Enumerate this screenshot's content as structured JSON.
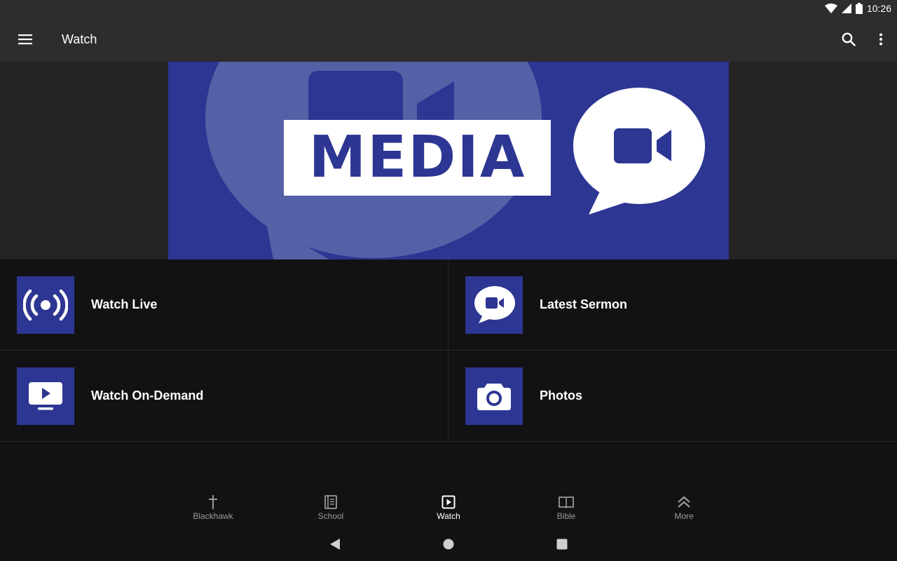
{
  "status_bar": {
    "time": "10:26"
  },
  "app_bar": {
    "title": "Watch"
  },
  "hero": {
    "text": "MEDIA",
    "colors": {
      "background": "#2d3692",
      "bubble_dim": "#5560a6",
      "accent": "#ffffff"
    }
  },
  "tiles": [
    {
      "label": "Watch Live",
      "icon": "broadcast-icon"
    },
    {
      "label": "Latest Sermon",
      "icon": "video-chat-icon"
    },
    {
      "label": "Watch On-Demand",
      "icon": "tv-play-icon"
    },
    {
      "label": "Photos",
      "icon": "camera-icon"
    }
  ],
  "bottom_nav": {
    "items": [
      {
        "label": "Blackhawk",
        "icon": "cross-icon"
      },
      {
        "label": "School",
        "icon": "book-icon"
      },
      {
        "label": "Watch",
        "icon": "play-square-icon",
        "active": true
      },
      {
        "label": "Bible",
        "icon": "open-book-icon"
      },
      {
        "label": "More",
        "icon": "chevrons-up-icon"
      }
    ]
  },
  "system_nav": {
    "buttons": [
      "back",
      "home",
      "recents"
    ]
  }
}
